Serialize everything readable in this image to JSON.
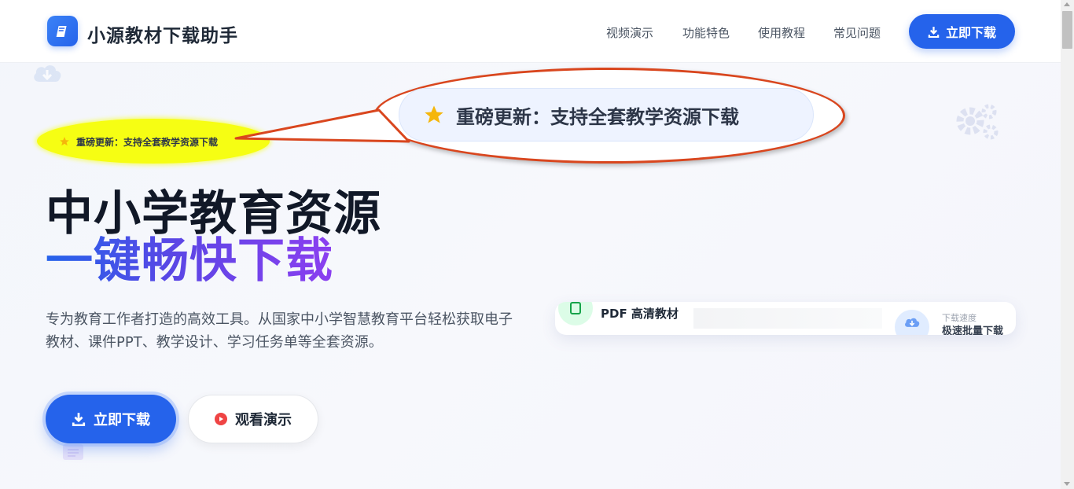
{
  "header": {
    "brand": "小源教材下载助手",
    "nav": [
      "视频演示",
      "功能特色",
      "使用教程",
      "常见问题"
    ],
    "cta_label": "立即下载"
  },
  "badge": {
    "text": "重磅更新：支持全套教学资源下载",
    "icon": "star-icon",
    "icon_color": "#f5b60b"
  },
  "hero": {
    "line1": "中小学教育资源",
    "line2": "一键畅快下载",
    "description": "专为教育工作者打造的高效工具。从国家中小学智慧教育平台轻松获取电子教材、课件PPT、教学设计、学习任务单等全套资源。",
    "primary_label": "立即下载",
    "secondary_label": "观看演示"
  },
  "preview": {
    "title": "PDF 高清教材",
    "speed_label": "下载速度",
    "speed_value": "极速批量下载"
  },
  "colors": {
    "accent": "#2563eb",
    "gradient_end": "#8b3ff0",
    "highlight": "#f7ff00",
    "callout_border": "#d9461e"
  }
}
